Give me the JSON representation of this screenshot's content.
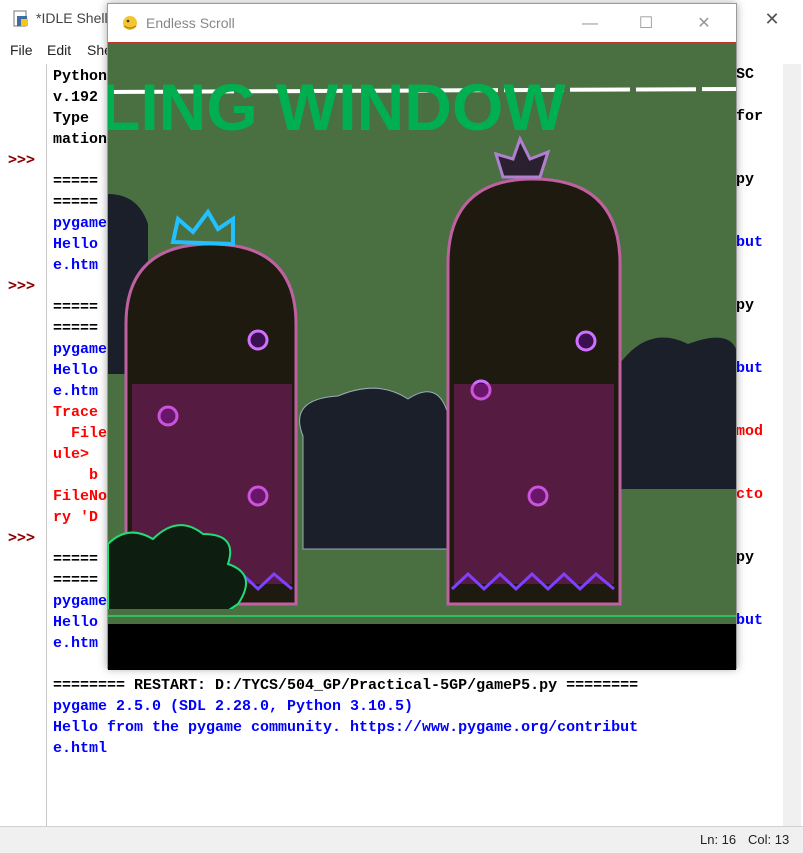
{
  "idle": {
    "title": "*IDLE Shell",
    "menu": [
      "File",
      "Edit",
      "She"
    ],
    "prompt_symbol": ">>>",
    "lines": [
      {
        "text": "Python",
        "color": "black"
      },
      {
        "text": "v.192",
        "color": "black"
      },
      {
        "text": "Type",
        "color": "black"
      },
      {
        "text": "mation",
        "color": "black"
      },
      {
        "text": "",
        "color": "black"
      },
      {
        "text": "=====",
        "color": "black"
      },
      {
        "text": "=====",
        "color": "black"
      },
      {
        "text": "pygame",
        "color": "blue"
      },
      {
        "text": "Hello",
        "color": "blue"
      },
      {
        "text": "e.htm",
        "color": "blue"
      },
      {
        "text": "",
        "color": "black"
      },
      {
        "text": "=====",
        "color": "black"
      },
      {
        "text": "=====",
        "color": "black"
      },
      {
        "text": "pygame",
        "color": "blue"
      },
      {
        "text": "Hello",
        "color": "blue"
      },
      {
        "text": "e.htm",
        "color": "blue"
      },
      {
        "text": "Trace",
        "color": "red"
      },
      {
        "text": "  File",
        "color": "red"
      },
      {
        "text": "ule>",
        "color": "red"
      },
      {
        "text": "    b",
        "color": "red"
      },
      {
        "text": "FileNo",
        "color": "red"
      },
      {
        "text": "ry 'D",
        "color": "red"
      },
      {
        "text": "",
        "color": "black"
      },
      {
        "text": "=====",
        "color": "black"
      },
      {
        "text": "=====",
        "color": "black"
      },
      {
        "text": "pygame",
        "color": "blue"
      },
      {
        "text": "Hello",
        "color": "blue"
      },
      {
        "text": "e.htm",
        "color": "blue"
      },
      {
        "text": "",
        "color": "black"
      },
      {
        "text": "======== RESTART: D:/TYCS/504_GP/Practical-5GP/gameP5.py ========",
        "color": "black"
      },
      {
        "text": "pygame 2.5.0 (SDL 2.28.0, Python 3.10.5)",
        "color": "blue"
      },
      {
        "text": "Hello from the pygame community. https://www.pygame.org/contribut",
        "color": "blue"
      },
      {
        "text": "e.html",
        "color": "blue"
      }
    ],
    "edge_fragments": [
      {
        "text": "SC",
        "color": "black"
      },
      {
        "text": "for",
        "color": "black"
      },
      {
        "text": "py",
        "color": "black"
      },
      {
        "text": "but",
        "color": "blue"
      },
      {
        "text": "py",
        "color": "black"
      },
      {
        "text": "but",
        "color": "blue"
      },
      {
        "text": "mod",
        "color": "red"
      },
      {
        "text": "cto",
        "color": "red"
      },
      {
        "text": "py",
        "color": "black"
      },
      {
        "text": "but",
        "color": "blue"
      }
    ],
    "status": {
      "ln": "Ln: 16",
      "col": "Col: 13"
    }
  },
  "game": {
    "title": "Endless Scroll",
    "banner_text": "LING WINDOW",
    "colors": {
      "sky": "#4a7042",
      "banner": "#00b050",
      "ground": "#000000",
      "pipe": "#1e1a10"
    }
  }
}
